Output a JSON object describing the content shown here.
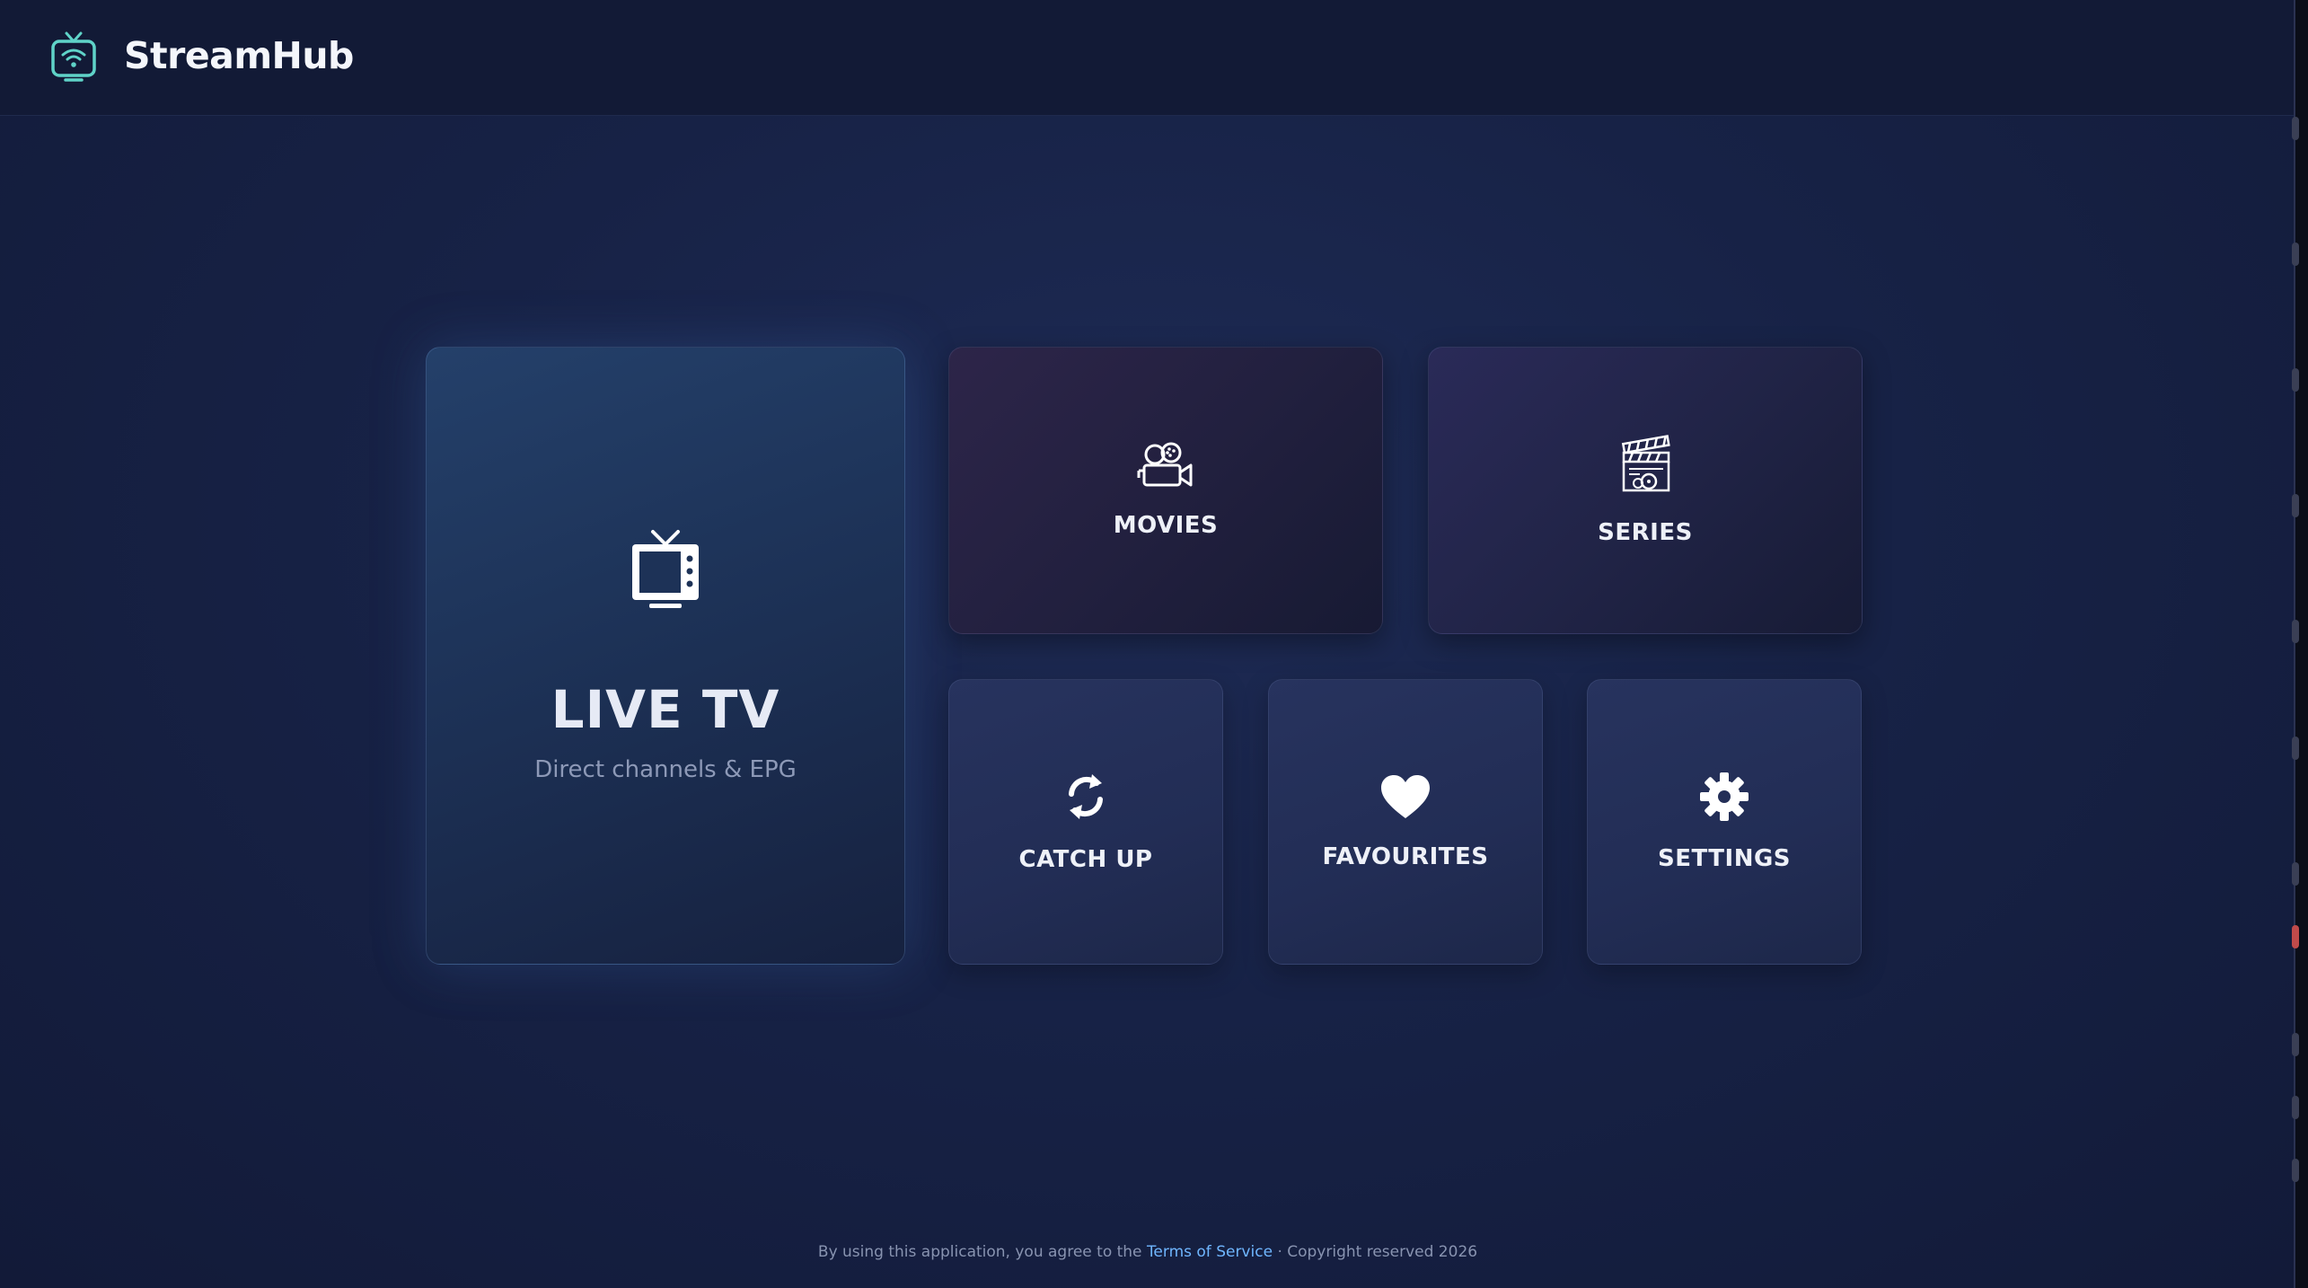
{
  "header": {
    "app_title": "StreamHub",
    "logo_icon": "tv-wifi-icon",
    "accent": "#5fd3c8"
  },
  "tiles": {
    "live_tv": {
      "title": "LIVE TV",
      "subtitle": "Direct channels & EPG",
      "icon": "retro-tv-icon"
    },
    "movies": {
      "label": "MOVIES",
      "icon": "movie-camera-icon"
    },
    "series": {
      "label": "SERIES",
      "icon": "clapperboard-icon"
    },
    "catch_up": {
      "label": "CATCH UP",
      "icon": "refresh-icon"
    },
    "favourites": {
      "label": "FAVOURITES",
      "icon": "heart-icon"
    },
    "settings": {
      "label": "SETTINGS",
      "icon": "gear-icon"
    }
  },
  "footer": {
    "prefix": "By using this application, you agree to the",
    "link": "Terms of Service",
    "suffix": "· Copyright reserved 2026"
  }
}
